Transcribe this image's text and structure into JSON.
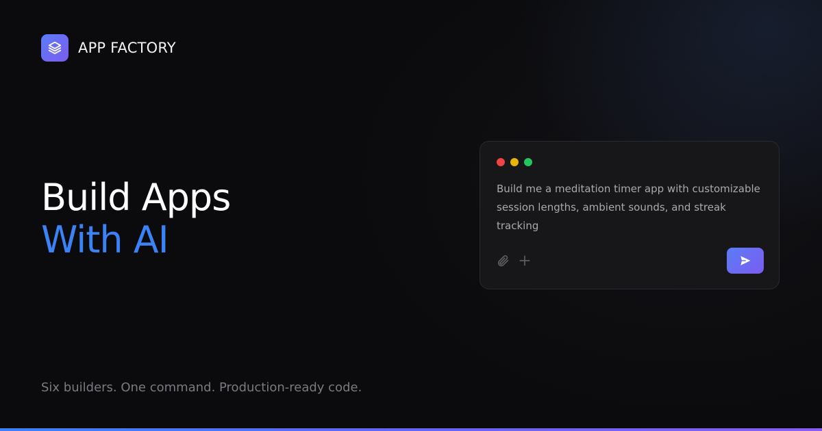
{
  "brand": {
    "name": "APP FACTORY",
    "icon": "layers-icon"
  },
  "hero": {
    "line1": "Build Apps",
    "line2": "With AI"
  },
  "tagline": "Six builders. One command. Production-ready code.",
  "prompt_card": {
    "window_dots": [
      "#ef4444",
      "#eab308",
      "#22c55e"
    ],
    "text": "Build me a meditation timer app with customizable session lengths, ambient sounds, and streak tracking",
    "tools": [
      "paperclip-icon",
      "plus-icon"
    ],
    "send_icon": "send-icon"
  },
  "colors": {
    "background": "#0b0b0d",
    "accent_blue": "#3b82f6",
    "accent_gradient": [
      "#5b7cf6",
      "#7b5cf0"
    ],
    "card_bg": "#17171a"
  }
}
